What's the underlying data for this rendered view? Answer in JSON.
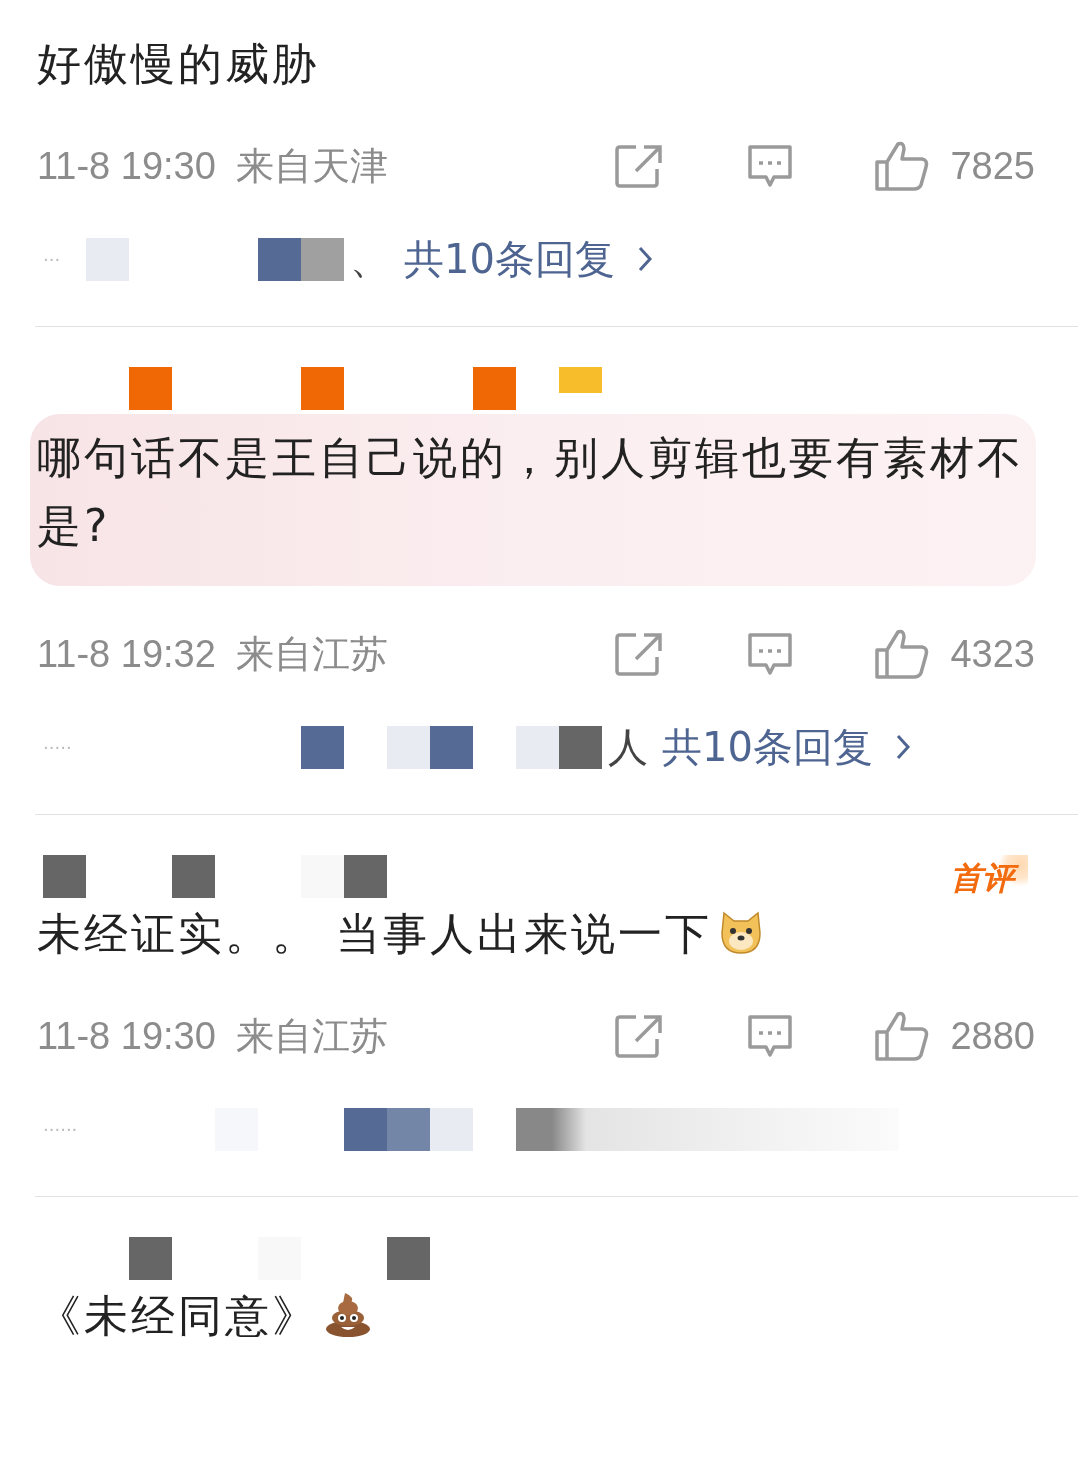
{
  "comments": [
    {
      "text": "好傲慢的威胁",
      "highlighted": false,
      "time": "11-8 19:30",
      "location": "来自天津",
      "likes": "7825",
      "replies": {
        "dots": "···",
        "mosaic": [
          {
            "kind": "tile",
            "color": "#e8ecf2"
          },
          {
            "kind": "gap"
          },
          {
            "kind": "gap"
          },
          {
            "kind": "gap"
          },
          {
            "kind": "tile",
            "color": "#566a96"
          },
          {
            "kind": "tile",
            "color": "#a0a0a0"
          }
        ],
        "suffix": "、",
        "link": "共10条回复"
      }
    },
    {
      "username_mosaic": [
        {
          "kind": "gap"
        },
        {
          "kind": "gap"
        },
        {
          "kind": "gap"
        },
        {
          "kind": "tile",
          "color": "#f06806"
        },
        {
          "kind": "gap"
        },
        {
          "kind": "gap"
        },
        {
          "kind": "gap"
        },
        {
          "kind": "tile",
          "color": "#f06806"
        },
        {
          "kind": "gap"
        },
        {
          "kind": "gap"
        },
        {
          "kind": "gap"
        },
        {
          "kind": "tile",
          "color": "#f06806"
        },
        {
          "kind": "gap"
        },
        {
          "kind": "small",
          "color": "#f7bd2b"
        }
      ],
      "text": "哪句话不是王自己说的，别人剪辑也要有素材不是?",
      "highlighted": true,
      "time": "11-8 19:32",
      "location": "来自江苏",
      "likes": "4323",
      "replies": {
        "dots": "·····",
        "mosaic": [
          {
            "kind": "gap"
          },
          {
            "kind": "gap"
          },
          {
            "kind": "gap"
          },
          {
            "kind": "gap"
          },
          {
            "kind": "gap"
          },
          {
            "kind": "tile",
            "color": "#566a96"
          },
          {
            "kind": "gap"
          },
          {
            "kind": "tile",
            "color": "#e8ecf2"
          },
          {
            "kind": "tile",
            "color": "#566a96"
          },
          {
            "kind": "gap"
          },
          {
            "kind": "tile",
            "color": "#e8ecf2"
          },
          {
            "kind": "tile",
            "color": "#666666"
          }
        ],
        "suffix": "人",
        "link": "共10条回复"
      }
    },
    {
      "username_mosaic": [
        {
          "kind": "gap"
        },
        {
          "kind": "tile",
          "color": "#666666"
        },
        {
          "kind": "gap"
        },
        {
          "kind": "gap"
        },
        {
          "kind": "tile",
          "color": "#666666"
        },
        {
          "kind": "gap"
        },
        {
          "kind": "gap"
        },
        {
          "kind": "tile",
          "color": "#f8f8f8"
        },
        {
          "kind": "tile",
          "color": "#666666"
        }
      ],
      "badge": "首评",
      "text": "未经证实。。 当事人出来说一下",
      "emoji": {
        "kind": "dog"
      },
      "highlighted": false,
      "time": "11-8 19:30",
      "location": "来自江苏",
      "likes": "2880",
      "replies": {
        "dots": "······",
        "mosaic": [
          {
            "kind": "gap"
          },
          {
            "kind": "gap"
          },
          {
            "kind": "gap"
          },
          {
            "kind": "tile",
            "color": "#f6f7fa"
          },
          {
            "kind": "gap"
          },
          {
            "kind": "gap"
          },
          {
            "kind": "tile",
            "color": "#566a96"
          },
          {
            "kind": "tile",
            "color": "#7486a8"
          },
          {
            "kind": "tile",
            "color": "#e8ecf2"
          },
          {
            "kind": "gap"
          },
          {
            "kind": "blur",
            "color": "#888888"
          }
        ]
      }
    },
    {
      "username_mosaic": [
        {
          "kind": "gap"
        },
        {
          "kind": "gap"
        },
        {
          "kind": "gap"
        },
        {
          "kind": "tile",
          "color": "#666666"
        },
        {
          "kind": "gap"
        },
        {
          "kind": "gap"
        },
        {
          "kind": "tile",
          "color": "#f8f8f8"
        },
        {
          "kind": "gap"
        },
        {
          "kind": "gap"
        },
        {
          "kind": "tile",
          "color": "#666666"
        }
      ],
      "text": "《未经同意》",
      "emoji": {
        "kind": "poop"
      },
      "highlighted": false
    }
  ]
}
